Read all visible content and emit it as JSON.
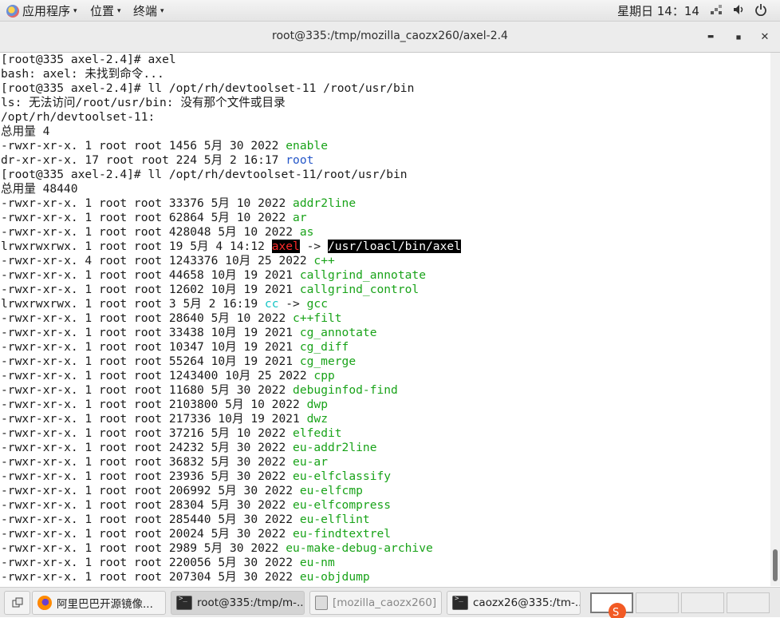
{
  "topbar": {
    "apps_label": "应用程序",
    "places_label": "位置",
    "terminal_label": "终端",
    "clock": "星期日 14：14"
  },
  "window": {
    "title": "root@335:/tmp/mozilla_caozx260/axel-2.4",
    "minimize_glyph": "▬",
    "maximize_glyph": "◼",
    "close_glyph": "✕"
  },
  "terminal": {
    "lines": [
      {
        "text": "[root@335 axel-2.4]# axel"
      },
      {
        "text": "bash: axel: 未找到命令..."
      },
      {
        "text": "[root@335 axel-2.4]# ll /opt/rh/devtoolset-11 /root/usr/bin"
      },
      {
        "text": "ls: 无法访问/root/usr/bin: 没有那个文件或目录"
      },
      {
        "text": "/opt/rh/devtoolset-11:"
      },
      {
        "text": "总用量 4"
      },
      {
        "text": "-rwxr-xr-x. 1 root root 1456 5月 30 2022 ",
        "name": "enable",
        "cls": "green"
      },
      {
        "text": "dr-xr-xr-x. 17 root root 224 5月 2 16:17 ",
        "name": "root",
        "cls": "blue"
      },
      {
        "text": "[root@335 axel-2.4]# ll /opt/rh/devtoolset-11/root/usr/bin"
      },
      {
        "text": "总用量 48440"
      },
      {
        "text": "-rwxr-xr-x. 1 root root 33376 5月 10 2022 ",
        "name": "addr2line",
        "cls": "green"
      },
      {
        "text": "-rwxr-xr-x. 1 root root 62864 5月 10 2022 ",
        "name": "ar",
        "cls": "green"
      },
      {
        "text": "-rwxr-xr-x. 1 root root 428048 5月 10 2022 ",
        "name": "as",
        "cls": "green"
      },
      {
        "text": "lrwxrwxrwx. 1 root root 19 5月 4 14:12 ",
        "name": "axel",
        "cls": "hl-red",
        "arrow": " -> ",
        "target": "/usr/loacl/bin/axel",
        "tcls": "hl-white"
      },
      {
        "text": "-rwxr-xr-x. 4 root root 1243376 10月 25 2022 ",
        "name": "c++",
        "cls": "green"
      },
      {
        "text": "-rwxr-xr-x. 1 root root 44658 10月 19 2021 ",
        "name": "callgrind_annotate",
        "cls": "green"
      },
      {
        "text": "-rwxr-xr-x. 1 root root 12602 10月 19 2021 ",
        "name": "callgrind_control",
        "cls": "green"
      },
      {
        "text": "lrwxrwxrwx. 1 root root 3 5月 2 16:19 ",
        "name": "cc",
        "cls": "cyan",
        "arrow": " -> ",
        "target": "gcc",
        "tcls": "green"
      },
      {
        "text": "-rwxr-xr-x. 1 root root 28640 5月 10 2022 ",
        "name": "c++filt",
        "cls": "green"
      },
      {
        "text": "-rwxr-xr-x. 1 root root 33438 10月 19 2021 ",
        "name": "cg_annotate",
        "cls": "green"
      },
      {
        "text": "-rwxr-xr-x. 1 root root 10347 10月 19 2021 ",
        "name": "cg_diff",
        "cls": "green"
      },
      {
        "text": "-rwxr-xr-x. 1 root root 55264 10月 19 2021 ",
        "name": "cg_merge",
        "cls": "green"
      },
      {
        "text": "-rwxr-xr-x. 1 root root 1243400 10月 25 2022 ",
        "name": "cpp",
        "cls": "green"
      },
      {
        "text": "-rwxr-xr-x. 1 root root 11680 5月 30 2022 ",
        "name": "debuginfod-find",
        "cls": "green"
      },
      {
        "text": "-rwxr-xr-x. 1 root root 2103800 5月 10 2022 ",
        "name": "dwp",
        "cls": "green"
      },
      {
        "text": "-rwxr-xr-x. 1 root root 217336 10月 19 2021 ",
        "name": "dwz",
        "cls": "green"
      },
      {
        "text": "-rwxr-xr-x. 1 root root 37216 5月 10 2022 ",
        "name": "elfedit",
        "cls": "green"
      },
      {
        "text": "-rwxr-xr-x. 1 root root 24232 5月 30 2022 ",
        "name": "eu-addr2line",
        "cls": "green"
      },
      {
        "text": "-rwxr-xr-x. 1 root root 36832 5月 30 2022 ",
        "name": "eu-ar",
        "cls": "green"
      },
      {
        "text": "-rwxr-xr-x. 1 root root 23936 5月 30 2022 ",
        "name": "eu-elfclassify",
        "cls": "green"
      },
      {
        "text": "-rwxr-xr-x. 1 root root 206992 5月 30 2022 ",
        "name": "eu-elfcmp",
        "cls": "green"
      },
      {
        "text": "-rwxr-xr-x. 1 root root 28304 5月 30 2022 ",
        "name": "eu-elfcompress",
        "cls": "green"
      },
      {
        "text": "-rwxr-xr-x. 1 root root 285440 5月 30 2022 ",
        "name": "eu-elflint",
        "cls": "green"
      },
      {
        "text": "-rwxr-xr-x. 1 root root 20024 5月 30 2022 ",
        "name": "eu-findtextrel",
        "cls": "green"
      },
      {
        "text": "-rwxr-xr-x. 1 root root 2989 5月 30 2022 ",
        "name": "eu-make-debug-archive",
        "cls": "green"
      },
      {
        "text": "-rwxr-xr-x. 1 root root 220056 5月 30 2022 ",
        "name": "eu-nm",
        "cls": "green"
      },
      {
        "text": "-rwxr-xr-x. 1 root root 207304 5月 30 2022 ",
        "name": "eu-objdump",
        "cls": "green"
      }
    ]
  },
  "taskbar": {
    "tasks": [
      {
        "label": "阿里巴巴开源镜像...",
        "icon": "firefox-icon"
      },
      {
        "label": "root@335:/tmp/m-...",
        "icon": "terminal-icon"
      },
      {
        "label": "[mozilla_caozx260]",
        "icon": "folder-icon"
      },
      {
        "label": "caozx26@335:/tm-...",
        "icon": "terminal-icon"
      }
    ]
  },
  "colors": {
    "exec_green": "#19a319",
    "dir_blue": "#2456c8",
    "link_cyan": "#15c4c4",
    "broken_link_red": "#ff2a2a"
  }
}
